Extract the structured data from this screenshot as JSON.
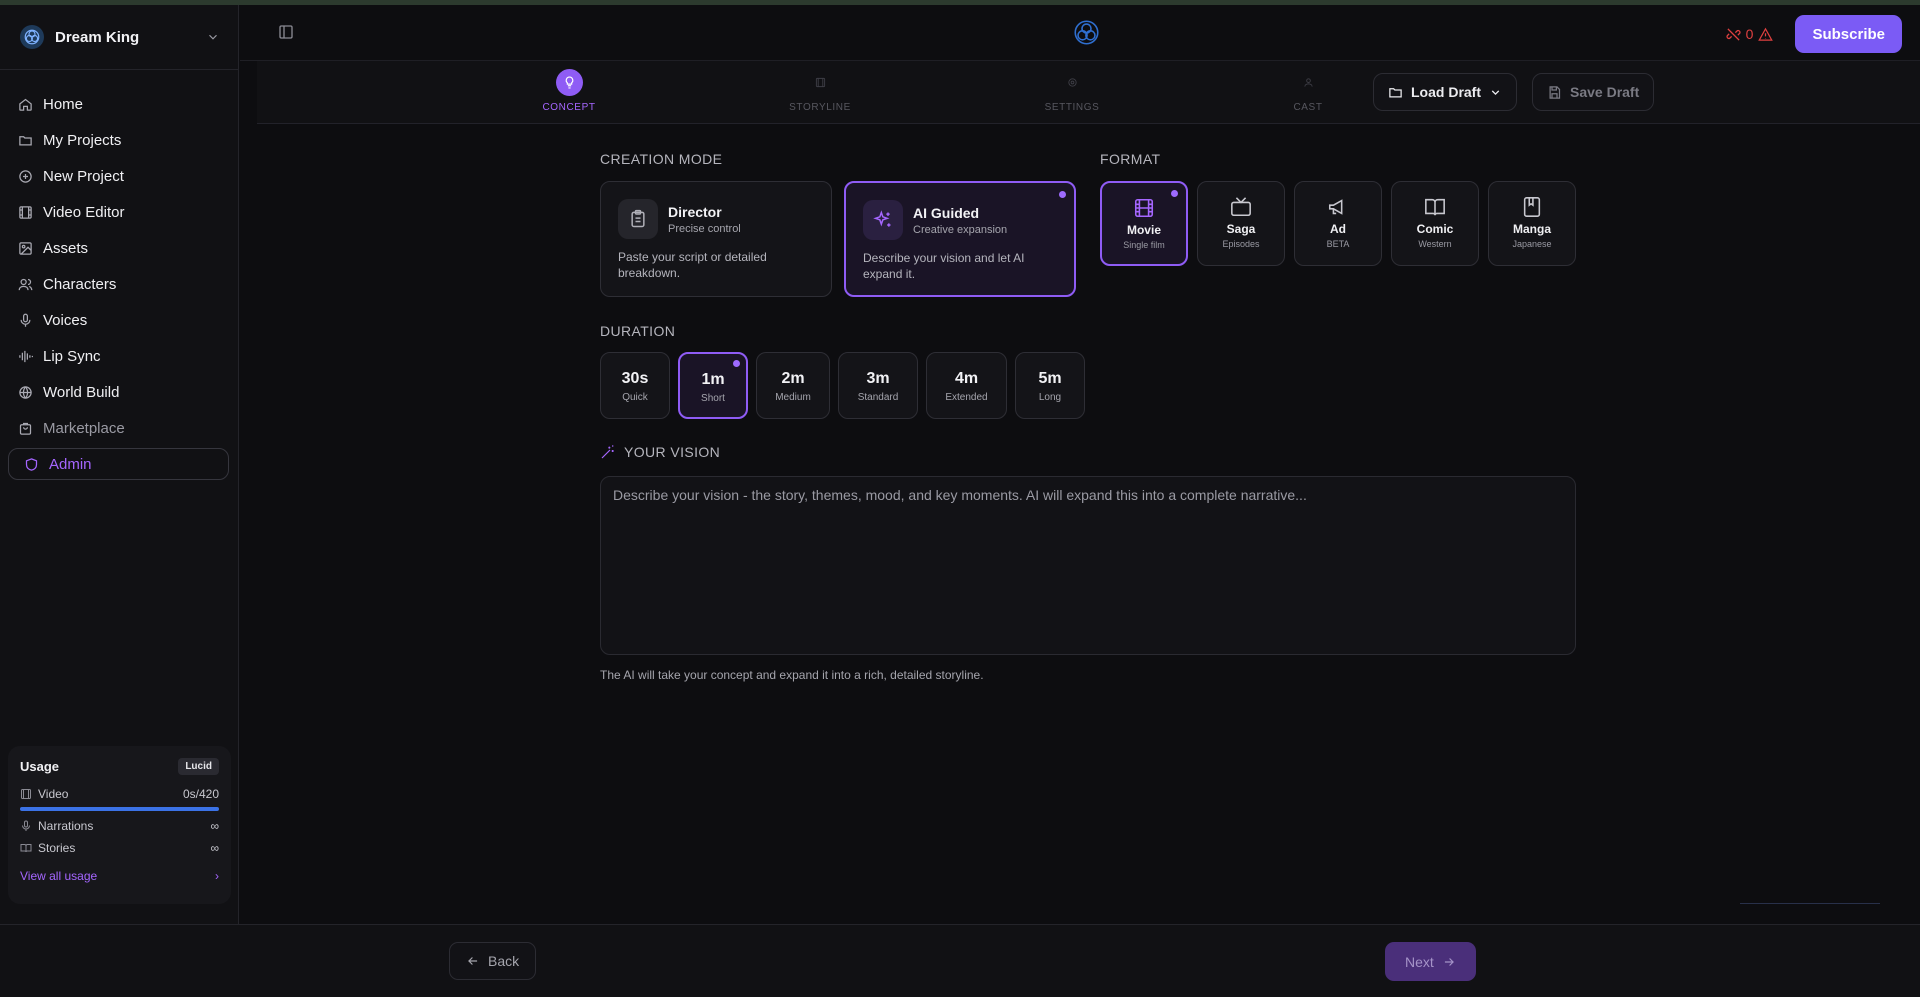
{
  "sidebar": {
    "brand": "Dream King",
    "items": [
      {
        "label": "Home",
        "icon": "home-icon"
      },
      {
        "label": "My Projects",
        "icon": "folder-icon"
      },
      {
        "label": "New Project",
        "icon": "plus-circle-icon"
      },
      {
        "label": "Video Editor",
        "icon": "film-icon"
      },
      {
        "label": "Assets",
        "icon": "image-icon"
      },
      {
        "label": "Characters",
        "icon": "users-icon"
      },
      {
        "label": "Voices",
        "icon": "mic-icon"
      },
      {
        "label": "Lip Sync",
        "icon": "waveform-icon"
      },
      {
        "label": "World Build",
        "icon": "globe-icon"
      },
      {
        "label": "Marketplace",
        "icon": "store-icon"
      },
      {
        "label": "Admin",
        "icon": "shield-icon"
      }
    ],
    "usage": {
      "title": "Usage",
      "plan": "Lucid",
      "video_label": "Video",
      "video_value": "0s/420",
      "narrations_label": "Narrations",
      "narrations_value": "∞",
      "stories_label": "Stories",
      "stories_value": "∞",
      "view_all": "View all usage",
      "view_all_chevron": "›"
    }
  },
  "header": {
    "warning_count": "0",
    "subscribe_label": "Subscribe"
  },
  "steps": [
    {
      "label": "CONCEPT"
    },
    {
      "label": "STORYLINE"
    },
    {
      "label": "SETTINGS"
    },
    {
      "label": "CAST"
    }
  ],
  "drafts": {
    "load_label": "Load Draft",
    "save_label": "Save Draft"
  },
  "creation_mode": {
    "title": "CREATION MODE",
    "options": [
      {
        "name": "Director",
        "subtitle": "Precise control",
        "description": "Paste your script or detailed breakdown."
      },
      {
        "name": "AI Guided",
        "subtitle": "Creative expansion",
        "description": "Describe your vision and let AI expand it."
      }
    ]
  },
  "format": {
    "title": "FORMAT",
    "options": [
      {
        "name": "Movie",
        "subtitle": "Single film"
      },
      {
        "name": "Saga",
        "subtitle": "Episodes"
      },
      {
        "name": "Ad",
        "subtitle": "BETA"
      },
      {
        "name": "Comic",
        "subtitle": "Western"
      },
      {
        "name": "Manga",
        "subtitle": "Japanese"
      }
    ]
  },
  "duration": {
    "title": "DURATION",
    "options": [
      {
        "name": "30s",
        "subtitle": "Quick"
      },
      {
        "name": "1m",
        "subtitle": "Short"
      },
      {
        "name": "2m",
        "subtitle": "Medium"
      },
      {
        "name": "3m",
        "subtitle": "Standard"
      },
      {
        "name": "4m",
        "subtitle": "Extended"
      },
      {
        "name": "5m",
        "subtitle": "Long"
      }
    ]
  },
  "vision": {
    "title": "YOUR VISION",
    "placeholder": "Describe your vision - the story, themes, mood, and key moments. AI will expand this into a complete narrative...",
    "helper": "The AI will take your concept and expand it into a rich, detailed storyline."
  },
  "footer": {
    "back_label": "Back",
    "next_label": "Next"
  },
  "colors": {
    "accent": "#8f5cf5",
    "subscribe": "#7b5bf5",
    "usage_bar": "#3b72e6",
    "warning": "#e04040"
  }
}
